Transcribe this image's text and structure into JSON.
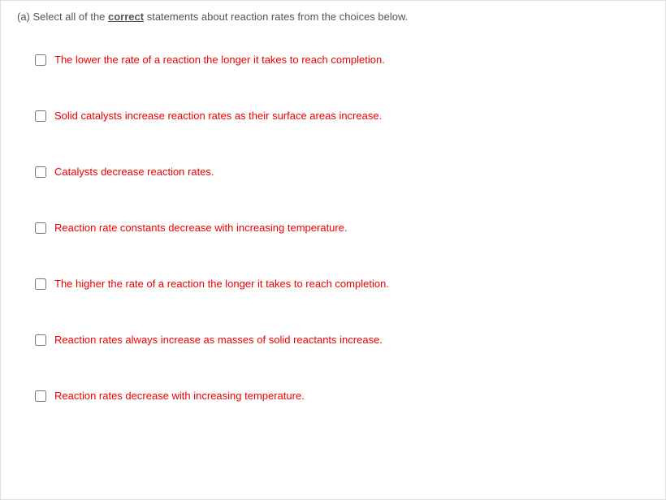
{
  "prompt": {
    "part": "(a)",
    "before": "Select all of the ",
    "emph": "correct",
    "after": " statements about reaction rates from the choices below."
  },
  "options": [
    {
      "label": "The lower the rate of a reaction the longer it takes to reach completion."
    },
    {
      "label": "Solid catalysts increase reaction rates as their surface areas increase."
    },
    {
      "label": "Catalysts decrease reaction rates."
    },
    {
      "label": "Reaction rate constants decrease with increasing temperature."
    },
    {
      "label": "The higher the rate of a reaction the longer it takes to reach completion."
    },
    {
      "label": "Reaction rates always increase as masses of solid reactants increase."
    },
    {
      "label": "Reaction rates decrease with increasing temperature."
    }
  ]
}
